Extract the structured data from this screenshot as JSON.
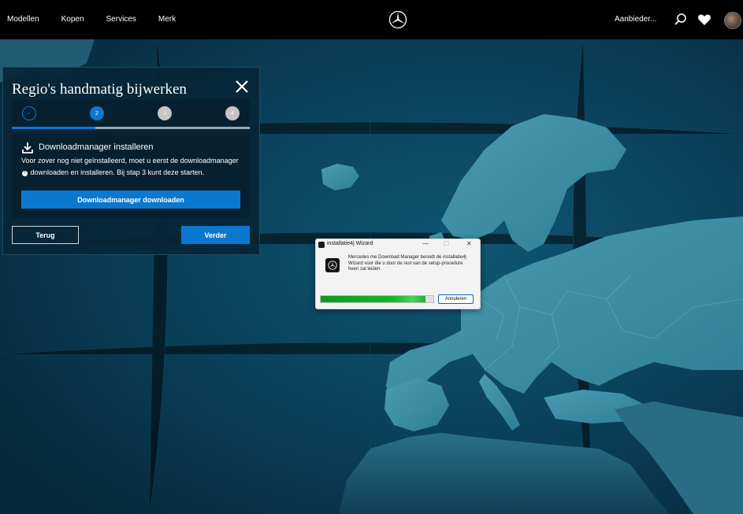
{
  "nav": {
    "links": [
      "Modellen",
      "Kopen",
      "Services",
      "Merk"
    ],
    "right_text": "Aanbieder...",
    "icons": [
      "search-icon",
      "heart-icon",
      "avatar"
    ]
  },
  "panel": {
    "title": "Regio's handmatig bijwerken",
    "steps": [
      {
        "label": "✓",
        "state": "done"
      },
      {
        "label": "2",
        "state": "active"
      },
      {
        "label": "3",
        "state": "pending"
      },
      {
        "label": "4",
        "state": "pending"
      }
    ],
    "progress_fraction": 0.35,
    "info_heading": "Downloadmanager installeren",
    "info_text_before": "Voor zover nog niet geïnstalleerd, moet u eerst de downloadmanager",
    "info_marker": "!",
    "info_text_after": "downloaden en installeren. Bij stap 3 kunt deze starten.",
    "download_button": "Downloadmanager downloaden",
    "back_button": "Terug",
    "next_button": "Verder"
  },
  "dialog": {
    "title": "installatie4j Wizard",
    "minimize": "—",
    "maximize": "☐",
    "close": "✕",
    "message": "Mercedes me Download Manager bereidt de installatie4j Wizard voor die u door de rest van de setup-procedure heen zal leiden.",
    "progress_fraction": 0.93,
    "cancel_button": "Annuleren"
  },
  "colors": {
    "accent": "#0b78d0",
    "topbar": "#000000",
    "map_sea": "#0a3a52",
    "map_land": "#3d8ea6",
    "progress": "#18b52d"
  }
}
